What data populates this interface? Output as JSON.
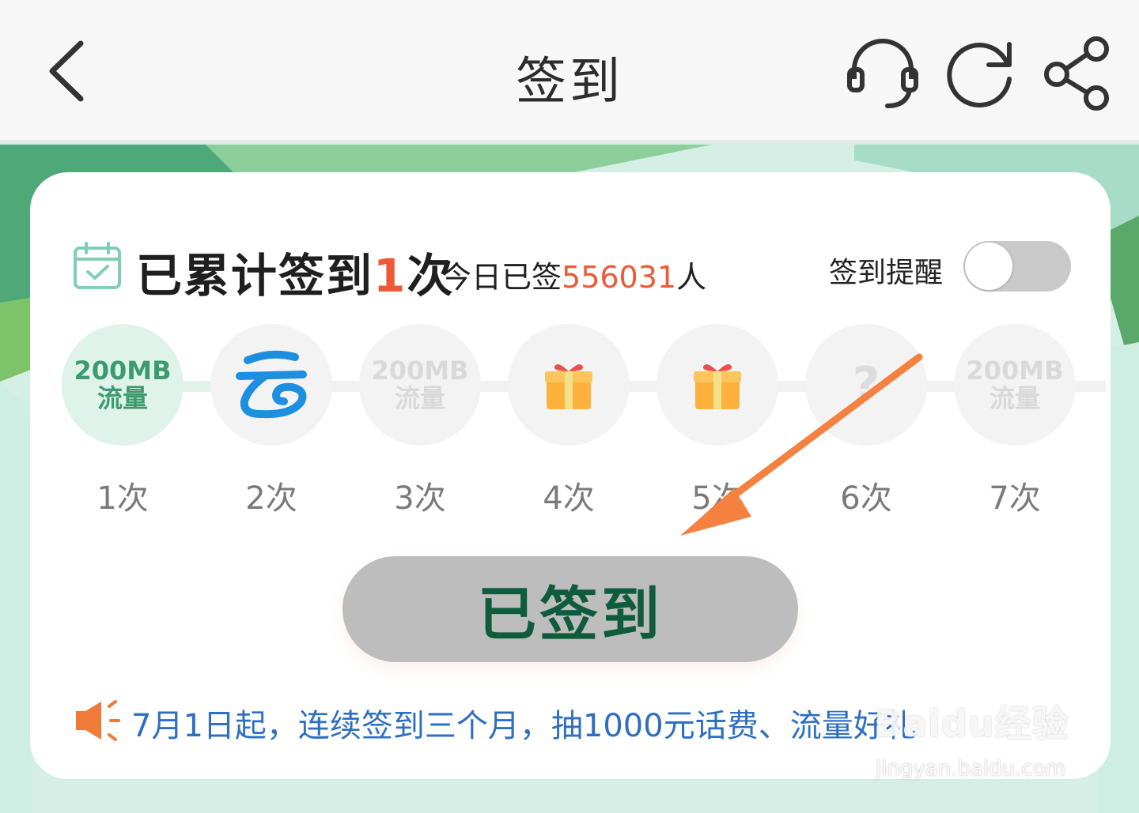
{
  "header": {
    "title": "签到",
    "icons": [
      "back-icon",
      "customer-service-icon",
      "refresh-icon",
      "share-icon"
    ]
  },
  "stats": {
    "count_prefix": "已累计签到",
    "count_value": "1",
    "count_suffix": "次",
    "today_prefix": "今日已签",
    "today_value": "556031",
    "today_suffix": "人"
  },
  "reminder": {
    "label": "签到提醒",
    "enabled": false
  },
  "days": [
    {
      "label": "1次",
      "reward_line1": "200MB",
      "reward_line2": "流量",
      "type": "flow",
      "done": true
    },
    {
      "label": "2次",
      "type": "cloud-icon",
      "done": false
    },
    {
      "label": "3次",
      "reward_line1": "200MB",
      "reward_line2": "流量",
      "type": "flow",
      "done": false
    },
    {
      "label": "4次",
      "type": "gift-icon",
      "done": false
    },
    {
      "label": "5次",
      "type": "gift-icon",
      "done": false
    },
    {
      "label": "6次",
      "reward_line1": "?",
      "type": "mystery",
      "done": false
    },
    {
      "label": "7次",
      "reward_line1": "200MB",
      "reward_line2": "流量",
      "type": "flow",
      "done": false
    }
  ],
  "button": {
    "label": "已签到"
  },
  "notice": {
    "text": "7月1日起，连续签到三个月，抽1000元话费、流量好礼"
  },
  "watermark": {
    "logo": "Baidu经验",
    "url": "jingyan.baidu.com"
  },
  "colors": {
    "accent_red": "#ec5a38",
    "button_text": "#0e5c3c",
    "notice_blue": "#2f6fc1",
    "arrow": "#f4813f"
  }
}
